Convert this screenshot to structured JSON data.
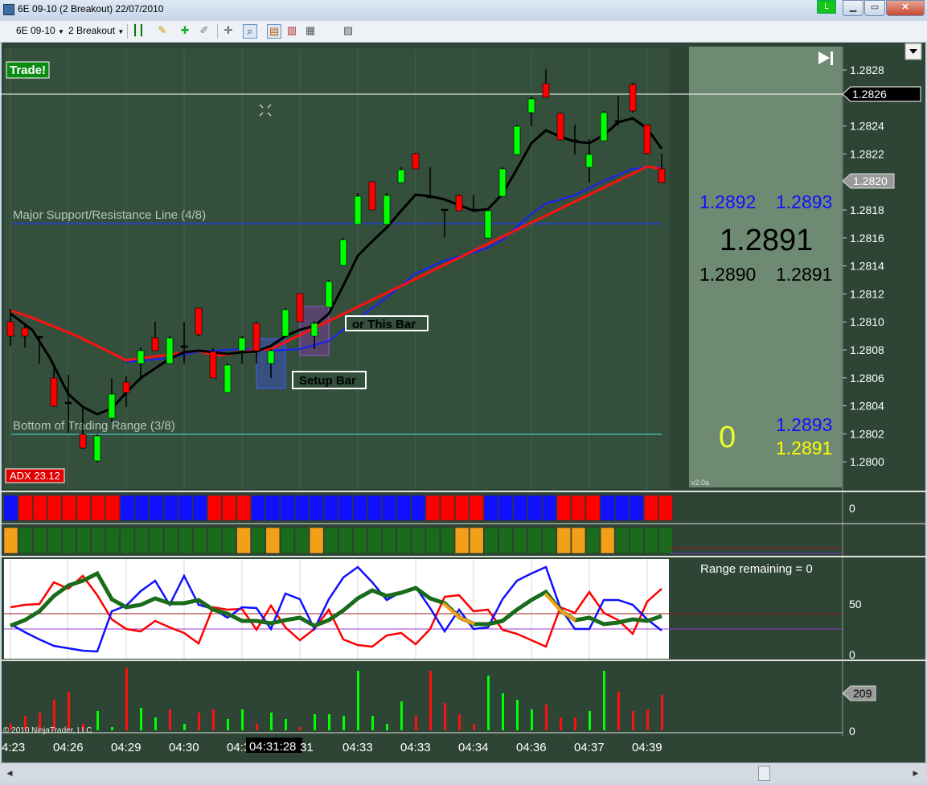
{
  "window": {
    "title": "6E 09-10 (2 Breakout)  22/07/2010",
    "badge": "L"
  },
  "toolbar": {
    "instrument": "6E 09-10",
    "strategy": "2 Breakout"
  },
  "chart": {
    "trade_label": "Trade!",
    "support_label": "Major Support/Resistance Line (4/8)",
    "bottom_label": "Bottom of Trading Range (3/8)",
    "setup_label": "Setup Bar",
    "or_label": "or This Bar",
    "adx_label": "ADX 23.12",
    "price_ticks": [
      "1.2828",
      "1.2826",
      "1.2824",
      "1.2822",
      "1.2820",
      "1.2818",
      "1.2816",
      "1.2814",
      "1.2812",
      "1.2810",
      "1.2808",
      "1.2806",
      "1.2804",
      "1.2802",
      "1.2800"
    ],
    "price_marker_top": "1.2826",
    "price_marker_last": "1.2820",
    "time_labels": [
      "4:23",
      "04:26",
      "04:29",
      "04:30",
      "04:3",
      "04:31:28",
      "31",
      "04:33",
      "04:33",
      "04:34",
      "04:36",
      "04:37",
      "04:39"
    ],
    "copyright": "© 2010 NinjaTrader, LLC"
  },
  "side_panel": {
    "bid": "1.2892",
    "ask": "1.2893",
    "last": "1.2891",
    "low_bid": "1.2890",
    "low_ask": "1.2891",
    "position": "0",
    "pos_ask": "1.2893",
    "pos_last": "1.2891",
    "version": "v2.0a"
  },
  "panels": {
    "row1_axis": "0",
    "osc_text": "Range remaining = 0",
    "osc_ticks": [
      "50",
      "0"
    ],
    "volume_marker": "209",
    "volume_zero": "0"
  },
  "colors": {
    "up": "#00ff00",
    "down": "#ff0000",
    "chart_bg": "#34503c",
    "panel": "#6f8a73"
  }
}
